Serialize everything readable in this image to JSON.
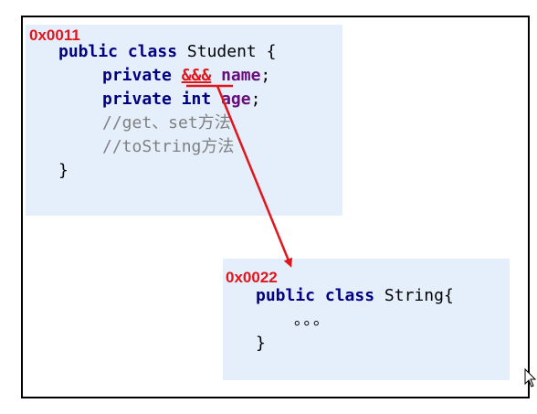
{
  "object1": {
    "address": "0x0011",
    "line1": {
      "kw1": "public",
      "kw2": "class",
      "name": "Student",
      "brace": "{"
    },
    "line2": {
      "kw": "private",
      "type": "&&&",
      "field": "name",
      "semi": ";"
    },
    "line3": {
      "kw": "private",
      "type": "int",
      "field": "age",
      "semi": ";"
    },
    "comment1": "//get、set方法",
    "comment2": "//toString方法",
    "close": "}"
  },
  "object2": {
    "address": "0x0022",
    "line1": {
      "kw1": "public",
      "kw2": "class",
      "name": "String",
      "brace": "{"
    },
    "ellipsis": "。。。",
    "close": "}"
  },
  "colors": {
    "pointer": "#e0161b",
    "box_fill": "#e5effb",
    "keyword": "#000080",
    "field": "#660e7a"
  },
  "icons": {
    "cursor": "mouse-pointer-icon"
  }
}
